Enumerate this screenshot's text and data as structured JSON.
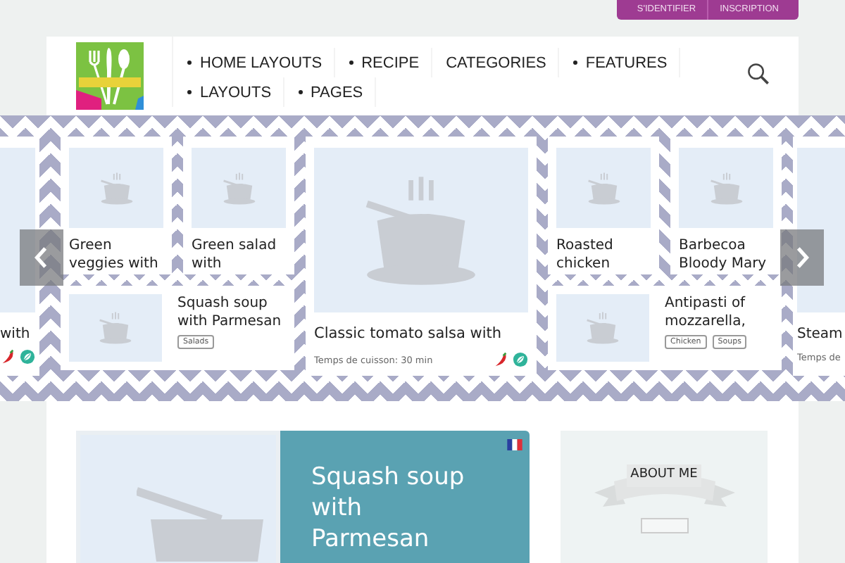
{
  "account_links": [
    {
      "label": "S'IDENTIFIER"
    },
    {
      "label": "INSCRIPTION"
    }
  ],
  "nav": [
    {
      "label": "HOME LAYOUTS",
      "dropdown": true
    },
    {
      "label": "RECIPE",
      "dropdown": true
    },
    {
      "label": "CATEGORIES",
      "dropdown": false
    },
    {
      "label": "FEATURES",
      "dropdown": true
    },
    {
      "label": "LAYOUTS",
      "dropdown": true
    },
    {
      "label": "PAGES",
      "dropdown": true
    }
  ],
  "slider": {
    "slides": [
      {
        "kind": "edge-left",
        "title": "with",
        "badges": [
          {
            "kind": "chili"
          },
          {
            "kind": "leaf"
          }
        ]
      },
      {
        "kind": "grid",
        "cards": [
          {
            "title": "Green veggies with"
          },
          {
            "title": "Green salad with"
          },
          {
            "title": "Squash soup with Parmesan",
            "tags": [
              "Salads"
            ]
          }
        ]
      },
      {
        "kind": "big",
        "title": "Classic tomato salsa with",
        "meta": "Temps de cuisson: 30 min",
        "badges": [
          {
            "kind": "chili"
          },
          {
            "kind": "leaf"
          }
        ]
      },
      {
        "kind": "grid",
        "cards": [
          {
            "title": "Roasted chicken"
          },
          {
            "title": "Barbecoa Bloody Mary"
          },
          {
            "title": "Antipasti of mozzarella,",
            "tags": [
              "Chicken",
              "Soups"
            ]
          }
        ]
      },
      {
        "kind": "edge-right",
        "title": "Steam",
        "meta": "Temps de"
      }
    ]
  },
  "featured": {
    "title": "Squash soup with Parmesan"
  },
  "widget": {
    "title": "ABOUT ME"
  }
}
